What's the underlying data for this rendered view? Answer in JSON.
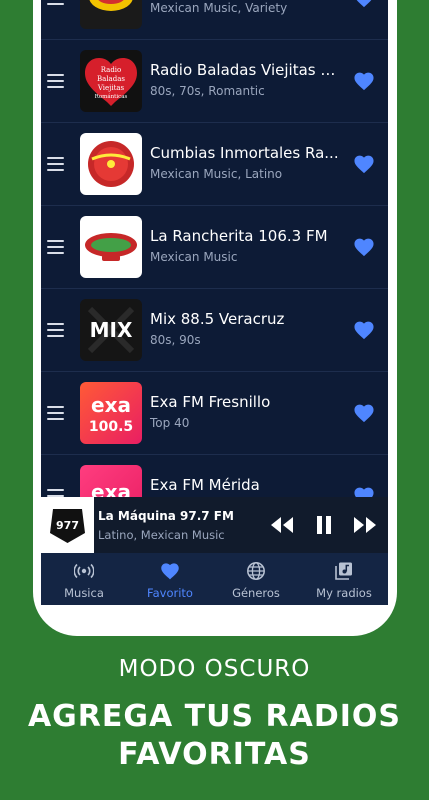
{
  "stations": [
    {
      "title": "",
      "subtitle": "Mexican Music, Variety",
      "logo": "radio-logo-yellow"
    },
    {
      "title": "Radio Baladas Viejitas R...",
      "subtitle": "80s, 70s, Romantic",
      "logo": "radio-baladas-logo",
      "logo_text": "Radio Baladas Viejitas Románticas"
    },
    {
      "title": "Cumbias Inmortales Ra...",
      "subtitle": "Mexican Music, Latino",
      "logo": "cumbias-logo"
    },
    {
      "title": "La Rancherita 106.3 FM",
      "subtitle": "Mexican Music",
      "logo": "rancherita-logo"
    },
    {
      "title": "Mix 88.5 Veracruz",
      "subtitle": "80s, 90s",
      "logo": "mix-logo",
      "logo_text": "MIX"
    },
    {
      "title": "Exa FM Fresnillo",
      "subtitle": "Top 40",
      "logo": "exa-logo",
      "logo_text": "exa",
      "logo_num": "100.5"
    },
    {
      "title": "Exa FM Mérida",
      "subtitle": "",
      "logo": "exa-logo",
      "logo_text": "exa"
    }
  ],
  "player": {
    "title": "La Máquina 97.7 FM",
    "subtitle": "Latino, Mexican Music",
    "logo_text": "977"
  },
  "nav": [
    {
      "label": "Musica",
      "icon": "radio-waves-icon",
      "active": false
    },
    {
      "label": "Favorito",
      "icon": "heart-icon",
      "active": true
    },
    {
      "label": "Géneros",
      "icon": "globe-icon",
      "active": false
    },
    {
      "label": "My radios",
      "icon": "music-library-icon",
      "active": false
    }
  ],
  "caption": {
    "line1": "MODO OSCURO",
    "line2": "AGREGA TUS RADIOS",
    "line3": "FAVORITAS"
  },
  "colors": {
    "background": "#2e7d32",
    "screen": "#0d1b36",
    "heart": "#4f86ff",
    "nav_active": "#4f86ff"
  }
}
